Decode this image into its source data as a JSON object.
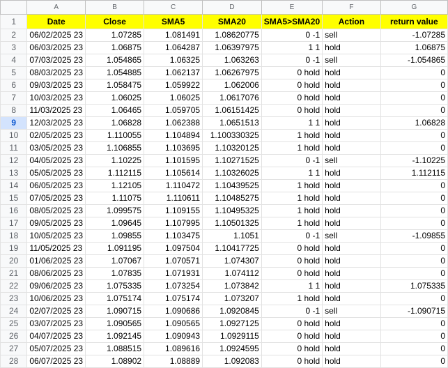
{
  "columns": [
    "A",
    "B",
    "C",
    "D",
    "E",
    "F",
    "G"
  ],
  "header": [
    "Date",
    "Close",
    "SMA5",
    "SMA20",
    "SMA5>SMA20",
    "Action",
    "return value"
  ],
  "rows": [
    {
      "n": "2",
      "date": "06/02/2025 23",
      "close": "1.07285",
      "sma5": "1.081491",
      "sma20": "1.08620775",
      "cmp": "0 -1",
      "action": "sell",
      "ret": "-1.07285"
    },
    {
      "n": "3",
      "date": "06/03/2025 23",
      "close": "1.06875",
      "sma5": "1.064287",
      "sma20": "1.06397975",
      "cmp": "1 1",
      "action": "hold",
      "ret": "1.06875"
    },
    {
      "n": "4",
      "date": "07/03/2025 23",
      "close": "1.054865",
      "sma5": "1.06325",
      "sma20": "1.063263",
      "cmp": "0 -1",
      "action": "sell",
      "ret": "-1.054865"
    },
    {
      "n": "5",
      "date": "08/03/2025 23",
      "close": "1.054885",
      "sma5": "1.062137",
      "sma20": "1.06267975",
      "cmp": "0 hold",
      "action": "hold",
      "ret": "0"
    },
    {
      "n": "6",
      "date": "09/03/2025 23",
      "close": "1.058475",
      "sma5": "1.059922",
      "sma20": "1.062006",
      "cmp": "0 hold",
      "action": "hold",
      "ret": "0"
    },
    {
      "n": "7",
      "date": "10/03/2025 23",
      "close": "1.06025",
      "sma5": "1.06025",
      "sma20": "1.0617076",
      "cmp": "0 hold",
      "action": "hold",
      "ret": "0"
    },
    {
      "n": "8",
      "date": "11/03/2025 23",
      "close": "1.06465",
      "sma5": "1.059705",
      "sma20": "1.06151425",
      "cmp": "0 hold",
      "action": "hold",
      "ret": "0"
    },
    {
      "n": "9",
      "date": "12/03/2025 23",
      "close": "1.06828",
      "sma5": "1.062388",
      "sma20": "1.0651513",
      "cmp": "1 1",
      "action": "hold",
      "ret": "1.06828"
    },
    {
      "n": "10",
      "date": "02/05/2025 23",
      "close": "1.110055",
      "sma5": "1.104894",
      "sma20": "1.100330325",
      "cmp": "1 hold",
      "action": "hold",
      "ret": "0"
    },
    {
      "n": "11",
      "date": "03/05/2025 23",
      "close": "1.106855",
      "sma5": "1.103695",
      "sma20": "1.10320125",
      "cmp": "1 hold",
      "action": "hold",
      "ret": "0"
    },
    {
      "n": "12",
      "date": "04/05/2025 23",
      "close": "1.10225",
      "sma5": "1.101595",
      "sma20": "1.10271525",
      "cmp": "0 -1",
      "action": "sell",
      "ret": "-1.10225"
    },
    {
      "n": "13",
      "date": "05/05/2025 23",
      "close": "1.112115",
      "sma5": "1.105614",
      "sma20": "1.10326025",
      "cmp": "1 1",
      "action": "hold",
      "ret": "1.112115"
    },
    {
      "n": "14",
      "date": "06/05/2025 23",
      "close": "1.12105",
      "sma5": "1.110472",
      "sma20": "1.10439525",
      "cmp": "1 hold",
      "action": "hold",
      "ret": "0"
    },
    {
      "n": "15",
      "date": "07/05/2025 23",
      "close": "1.11075",
      "sma5": "1.110611",
      "sma20": "1.10485275",
      "cmp": "1 hold",
      "action": "hold",
      "ret": "0"
    },
    {
      "n": "16",
      "date": "08/05/2025 23",
      "close": "1.099575",
      "sma5": "1.109155",
      "sma20": "1.10495325",
      "cmp": "1 hold",
      "action": "hold",
      "ret": "0"
    },
    {
      "n": "17",
      "date": "09/05/2025 23",
      "close": "1.09645",
      "sma5": "1.107995",
      "sma20": "1.10501325",
      "cmp": "1 hold",
      "action": "hold",
      "ret": "0"
    },
    {
      "n": "18",
      "date": "10/05/2025 23",
      "close": "1.09855",
      "sma5": "1.103475",
      "sma20": "1.1051",
      "cmp": "0 -1",
      "action": "sell",
      "ret": "-1.09855"
    },
    {
      "n": "19",
      "date": "11/05/2025 23",
      "close": "1.091195",
      "sma5": "1.097504",
      "sma20": "1.10417725",
      "cmp": "0 hold",
      "action": "hold",
      "ret": "0"
    },
    {
      "n": "20",
      "date": "01/06/2025 23",
      "close": "1.07067",
      "sma5": "1.070571",
      "sma20": "1.074307",
      "cmp": "0 hold",
      "action": "hold",
      "ret": "0"
    },
    {
      "n": "21",
      "date": "08/06/2025 23",
      "close": "1.07835",
      "sma5": "1.071931",
      "sma20": "1.074112",
      "cmp": "0 hold",
      "action": "hold",
      "ret": "0"
    },
    {
      "n": "22",
      "date": "09/06/2025 23",
      "close": "1.075335",
      "sma5": "1.073254",
      "sma20": "1.073842",
      "cmp": "1 1",
      "action": "hold",
      "ret": "1.075335"
    },
    {
      "n": "23",
      "date": "10/06/2025 23",
      "close": "1.075174",
      "sma5": "1.075174",
      "sma20": "1.073207",
      "cmp": "1 hold",
      "action": "hold",
      "ret": "0"
    },
    {
      "n": "24",
      "date": "02/07/2025 23",
      "close": "1.090715",
      "sma5": "1.090686",
      "sma20": "1.0920845",
      "cmp": "0 -1",
      "action": "sell",
      "ret": "-1.090715"
    },
    {
      "n": "25",
      "date": "03/07/2025 23",
      "close": "1.090565",
      "sma5": "1.090565",
      "sma20": "1.0927125",
      "cmp": "0 hold",
      "action": "hold",
      "ret": "0"
    },
    {
      "n": "26",
      "date": "04/07/2025 23",
      "close": "1.092145",
      "sma5": "1.090943",
      "sma20": "1.0929115",
      "cmp": "0 hold",
      "action": "hold",
      "ret": "0"
    },
    {
      "n": "27",
      "date": "05/07/2025 23",
      "close": "1.088515",
      "sma5": "1.089616",
      "sma20": "1.0924595",
      "cmp": "0 hold",
      "action": "hold",
      "ret": "0"
    },
    {
      "n": "28",
      "date": "06/07/2025 23",
      "close": "1.08902",
      "sma5": "1.08889",
      "sma20": "1.092083",
      "cmp": "0 hold",
      "action": "hold",
      "ret": "0"
    }
  ],
  "header_row_number": "1",
  "selected_row": "9"
}
